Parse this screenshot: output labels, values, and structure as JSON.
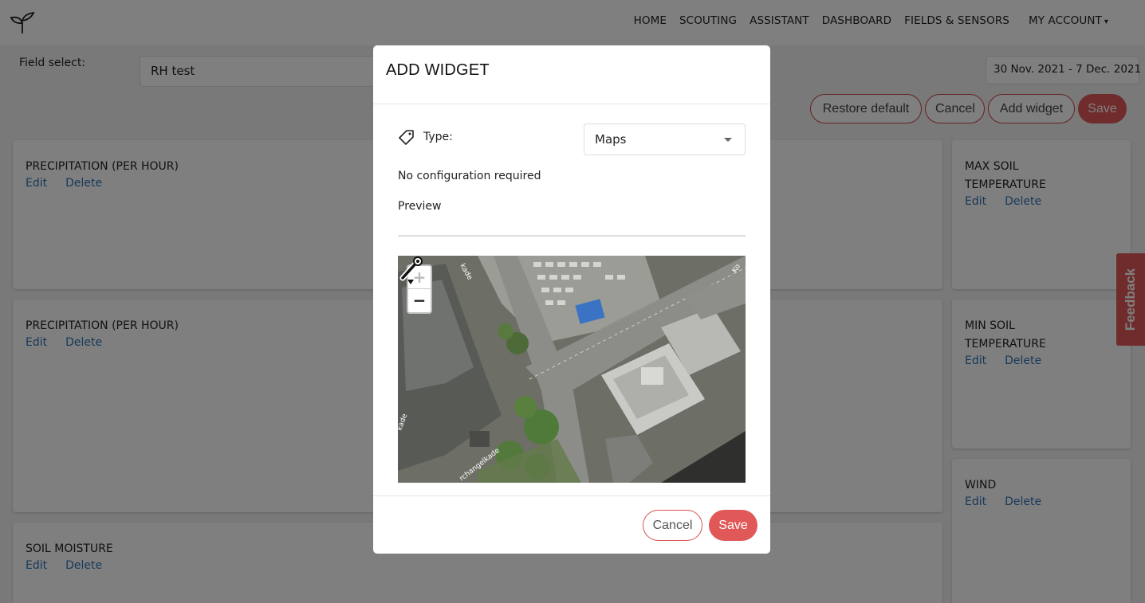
{
  "nav": {
    "items": [
      "HOME",
      "SCOUTING",
      "ASSISTANT",
      "DASHBOARD",
      "FIELDS & SENSORS",
      "MY ACCOUNT"
    ],
    "account_caret": "▾"
  },
  "filters": {
    "field_label": "Field select:",
    "field_value": "RH test",
    "date_range": "30 Nov. 2021 - 7 Dec. 2021"
  },
  "toolbar": {
    "restore_label": "Restore default",
    "cancel_label": "Cancel",
    "add_widget_label": "Add widget",
    "save_label": "Save"
  },
  "widgets": [
    {
      "title": "PRECIPITATION (PER HOUR)",
      "edit": "Edit",
      "delete": "Delete"
    },
    {
      "title": "PRECIPITATION (PER HOUR)",
      "edit": "Edit",
      "delete": "Delete"
    },
    {
      "title": "SOIL MOISTURE",
      "edit": "Edit",
      "delete": "Delete"
    },
    {
      "title": "MAX SOIL TEMPERATURE",
      "edit": "Edit",
      "delete": "Delete"
    },
    {
      "title": "MIN SOIL TEMPERATURE",
      "edit": "Edit",
      "delete": "Delete"
    },
    {
      "title": "WIND",
      "edit": "Edit",
      "delete": "Delete"
    }
  ],
  "feedback": "Feedback",
  "modal": {
    "title": "ADD WIDGET",
    "type_label": "Type:",
    "type_value": "Maps",
    "no_config": "No configuration required",
    "preview_label": "Preview",
    "map": {
      "zoom_in": "+",
      "zoom_out": "−",
      "street_labels": [
        "kade",
        "Ko",
        "rchangelkade",
        "kade"
      ],
      "icons": [
        "wrench-marker-icon"
      ]
    },
    "cancel_label": "Cancel",
    "save_label": "Save"
  },
  "colors": {
    "accent": "#e05858",
    "link": "#2f73b5",
    "overlay": "rgba(0,0,0,0.5)"
  }
}
